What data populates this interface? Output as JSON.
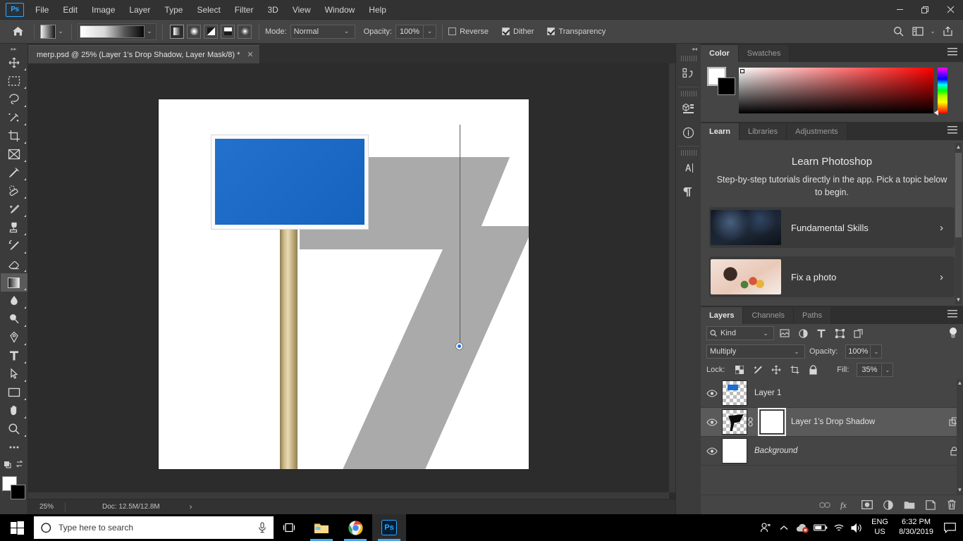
{
  "app": {
    "name": "Adobe Photoshop",
    "logo_text": "Ps"
  },
  "menubar": {
    "items": [
      {
        "label": "File"
      },
      {
        "label": "Edit"
      },
      {
        "label": "Image"
      },
      {
        "label": "Layer"
      },
      {
        "label": "Type"
      },
      {
        "label": "Select"
      },
      {
        "label": "Filter"
      },
      {
        "label": "3D"
      },
      {
        "label": "View"
      },
      {
        "label": "Window"
      },
      {
        "label": "Help"
      }
    ],
    "window_controls": {
      "minimize": "minimize-icon",
      "maximize": "maximize-icon",
      "close": "close-icon"
    }
  },
  "options_bar": {
    "tool": "Gradient Tool",
    "home_icon": "home-icon",
    "gradient_preset_label": "Foreground to Background",
    "gradient_types": [
      "linear-gradient",
      "radial-gradient",
      "angle-gradient",
      "reflected-gradient",
      "diamond-gradient"
    ],
    "gradient_type_selected": "linear-gradient",
    "mode_label": "Mode:",
    "mode_value": "Normal",
    "opacity_label": "Opacity:",
    "opacity_value": "100%",
    "reverse_label": "Reverse",
    "reverse_checked": false,
    "dither_label": "Dither",
    "dither_checked": true,
    "transparency_label": "Transparency",
    "transparency_checked": true,
    "right_icons": [
      "search-icon",
      "workspace-icon",
      "chevron-down-icon",
      "share-icon"
    ]
  },
  "toolbar": {
    "tools": [
      {
        "name": "move-tool",
        "icon": "move"
      },
      {
        "name": "rectangular-marquee-tool",
        "icon": "marquee"
      },
      {
        "name": "lasso-tool",
        "icon": "lasso"
      },
      {
        "name": "quick-selection-tool",
        "icon": "wand"
      },
      {
        "name": "crop-tool",
        "icon": "crop"
      },
      {
        "name": "frame-tool",
        "icon": "frame"
      },
      {
        "name": "eyedropper-tool",
        "icon": "eyedropper"
      },
      {
        "name": "spot-healing-brush-tool",
        "icon": "healing"
      },
      {
        "name": "brush-tool",
        "icon": "brush"
      },
      {
        "name": "clone-stamp-tool",
        "icon": "stamp"
      },
      {
        "name": "history-brush-tool",
        "icon": "history-brush"
      },
      {
        "name": "eraser-tool",
        "icon": "eraser"
      },
      {
        "name": "gradient-tool",
        "icon": "gradient",
        "active": true
      },
      {
        "name": "blur-tool",
        "icon": "blur"
      },
      {
        "name": "dodge-tool",
        "icon": "dodge"
      },
      {
        "name": "pen-tool",
        "icon": "pen"
      },
      {
        "name": "type-tool",
        "icon": "type"
      },
      {
        "name": "path-selection-tool",
        "icon": "path-select"
      },
      {
        "name": "rectangle-tool",
        "icon": "rectangle"
      },
      {
        "name": "hand-tool",
        "icon": "hand"
      },
      {
        "name": "zoom-tool",
        "icon": "zoom"
      },
      {
        "name": "edit-toolbar",
        "icon": "ellipsis"
      }
    ],
    "foreground_color": "#ffffff",
    "background_color": "#000000"
  },
  "document": {
    "tab_title": "merp.psd @ 25% (Layer 1's Drop Shadow, Layer Mask/8) *",
    "close_glyph": "✕"
  },
  "statusbar": {
    "zoom": "25%",
    "doc_label": "Doc: 12.5M/12.8M",
    "arrow": "›"
  },
  "icon_dock": {
    "items": [
      {
        "name": "history-panel-icon"
      },
      {
        "name": "3d-panel-icon"
      },
      {
        "name": "info-panel-icon"
      },
      {
        "name": "character-panel-icon"
      },
      {
        "name": "paragraph-panel-icon"
      }
    ],
    "collapse": "◂◂"
  },
  "color_panel": {
    "tabs": [
      {
        "label": "Color",
        "active": true
      },
      {
        "label": "Swatches",
        "active": false
      }
    ],
    "menu_icon": "panel-menu-icon",
    "foreground_color": "#ffffff",
    "background_color": "#000000"
  },
  "learn_panel": {
    "tabs": [
      {
        "label": "Learn",
        "active": true
      },
      {
        "label": "Libraries",
        "active": false
      },
      {
        "label": "Adjustments",
        "active": false
      }
    ],
    "menu_icon": "panel-menu-icon",
    "title": "Learn Photoshop",
    "subtitle": "Step-by-step tutorials directly in the app. Pick a topic below to begin.",
    "cards": [
      {
        "label": "Fundamental Skills",
        "arrow": "›",
        "thumb": "dark-room-photo"
      },
      {
        "label": "Fix a photo",
        "arrow": "›",
        "thumb": "flower-bouquet-photo"
      }
    ]
  },
  "layers_panel": {
    "tabs": [
      {
        "label": "Layers",
        "active": true
      },
      {
        "label": "Channels",
        "active": false
      },
      {
        "label": "Paths",
        "active": false
      }
    ],
    "menu_icon": "panel-menu-icon",
    "filter": {
      "search_icon": "search-icon",
      "kind_label": "Kind",
      "chevron": "⌄",
      "type_filters": [
        "pixel-layer-filter-icon",
        "adjustment-layer-filter-icon",
        "type-layer-filter-icon",
        "shape-layer-filter-icon",
        "smart-object-filter-icon"
      ],
      "toggle": "filter-toggle-icon"
    },
    "blend_mode_label": "Multiply",
    "opacity_label": "Opacity:",
    "opacity_value": "100%",
    "lock_label": "Lock:",
    "lock_icons": [
      "lock-transparent-pixels-icon",
      "lock-image-pixels-icon",
      "lock-position-icon",
      "lock-artboard-nesting-icon",
      "lock-all-icon"
    ],
    "fill_label": "Fill:",
    "fill_value": "35%",
    "layers": [
      {
        "name": "Layer 1",
        "visible": true,
        "selected": false,
        "italic": false,
        "has_mask": false,
        "locked": false,
        "thumb": "blue-sign-thumbnail"
      },
      {
        "name": "Layer 1's Drop Shadow",
        "visible": true,
        "selected": true,
        "italic": false,
        "has_mask": true,
        "locked": false,
        "thumb": "black-shadow-thumbnail",
        "right_icon": "smart-object-icon"
      },
      {
        "name": "Background",
        "visible": true,
        "selected": false,
        "italic": true,
        "has_mask": false,
        "locked": true,
        "thumb": "white-background-thumbnail"
      }
    ],
    "footer_icons": [
      {
        "name": "link-layers-icon",
        "glyph": "⚭"
      },
      {
        "name": "layer-style-fx-icon",
        "glyph": "fx"
      },
      {
        "name": "add-layer-mask-icon",
        "glyph": ""
      },
      {
        "name": "new-fill-adjustment-layer-icon",
        "glyph": ""
      },
      {
        "name": "new-group-icon",
        "glyph": ""
      },
      {
        "name": "new-layer-icon",
        "glyph": ""
      },
      {
        "name": "delete-layer-icon",
        "glyph": ""
      }
    ]
  },
  "canvas": {
    "artwork_description": "Blank blue road sign on wooden post with gray drop shadow",
    "sign_color": "#1568c8",
    "shadow_color": "#aaaaaa",
    "background_color": "#ffffff",
    "path_anchor_color": "#1473e6"
  },
  "taskbar": {
    "start_icon": "windows-start-icon",
    "search_placeholder": "Type here to search",
    "search_icon": "search-circle-icon",
    "mic_icon": "microphone-icon",
    "task_view_icon": "task-view-icon",
    "apps": [
      {
        "name": "file-explorer-icon",
        "running": true,
        "active": false
      },
      {
        "name": "google-chrome-icon",
        "running": true,
        "active": false
      },
      {
        "name": "photoshop-icon",
        "running": true,
        "active": true,
        "label": "Ps"
      }
    ],
    "tray": {
      "people_icon": "people-icon",
      "show_hidden_icon": "chevron-up-icon",
      "onedrive_icon": "onedrive-error-icon",
      "battery_icon": "battery-icon",
      "wifi_icon": "wifi-icon",
      "volume_icon": "volume-icon",
      "language_line1": "ENG",
      "language_line2": "US",
      "time": "6:32 PM",
      "date": "8/30/2019",
      "action_center_icon": "action-center-icon"
    }
  }
}
